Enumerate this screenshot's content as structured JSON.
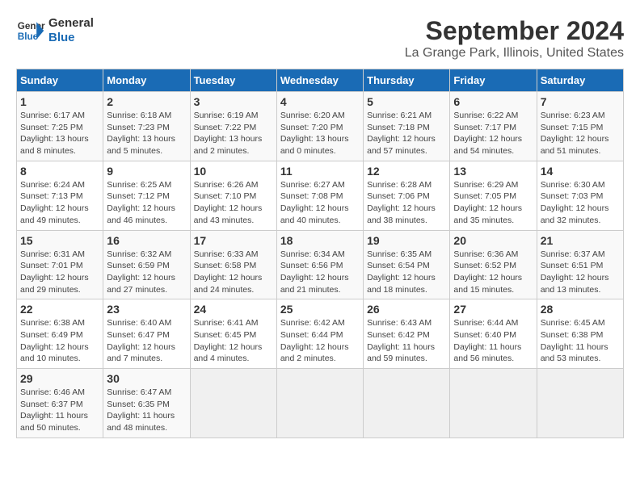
{
  "header": {
    "logo_line1": "General",
    "logo_line2": "Blue",
    "title": "September 2024",
    "subtitle": "La Grange Park, Illinois, United States"
  },
  "days_of_week": [
    "Sunday",
    "Monday",
    "Tuesday",
    "Wednesday",
    "Thursday",
    "Friday",
    "Saturday"
  ],
  "weeks": [
    [
      {
        "day": "1",
        "info": "Sunrise: 6:17 AM\nSunset: 7:25 PM\nDaylight: 13 hours\nand 8 minutes."
      },
      {
        "day": "2",
        "info": "Sunrise: 6:18 AM\nSunset: 7:23 PM\nDaylight: 13 hours\nand 5 minutes."
      },
      {
        "day": "3",
        "info": "Sunrise: 6:19 AM\nSunset: 7:22 PM\nDaylight: 13 hours\nand 2 minutes."
      },
      {
        "day": "4",
        "info": "Sunrise: 6:20 AM\nSunset: 7:20 PM\nDaylight: 13 hours\nand 0 minutes."
      },
      {
        "day": "5",
        "info": "Sunrise: 6:21 AM\nSunset: 7:18 PM\nDaylight: 12 hours\nand 57 minutes."
      },
      {
        "day": "6",
        "info": "Sunrise: 6:22 AM\nSunset: 7:17 PM\nDaylight: 12 hours\nand 54 minutes."
      },
      {
        "day": "7",
        "info": "Sunrise: 6:23 AM\nSunset: 7:15 PM\nDaylight: 12 hours\nand 51 minutes."
      }
    ],
    [
      {
        "day": "8",
        "info": "Sunrise: 6:24 AM\nSunset: 7:13 PM\nDaylight: 12 hours\nand 49 minutes."
      },
      {
        "day": "9",
        "info": "Sunrise: 6:25 AM\nSunset: 7:12 PM\nDaylight: 12 hours\nand 46 minutes."
      },
      {
        "day": "10",
        "info": "Sunrise: 6:26 AM\nSunset: 7:10 PM\nDaylight: 12 hours\nand 43 minutes."
      },
      {
        "day": "11",
        "info": "Sunrise: 6:27 AM\nSunset: 7:08 PM\nDaylight: 12 hours\nand 40 minutes."
      },
      {
        "day": "12",
        "info": "Sunrise: 6:28 AM\nSunset: 7:06 PM\nDaylight: 12 hours\nand 38 minutes."
      },
      {
        "day": "13",
        "info": "Sunrise: 6:29 AM\nSunset: 7:05 PM\nDaylight: 12 hours\nand 35 minutes."
      },
      {
        "day": "14",
        "info": "Sunrise: 6:30 AM\nSunset: 7:03 PM\nDaylight: 12 hours\nand 32 minutes."
      }
    ],
    [
      {
        "day": "15",
        "info": "Sunrise: 6:31 AM\nSunset: 7:01 PM\nDaylight: 12 hours\nand 29 minutes."
      },
      {
        "day": "16",
        "info": "Sunrise: 6:32 AM\nSunset: 6:59 PM\nDaylight: 12 hours\nand 27 minutes."
      },
      {
        "day": "17",
        "info": "Sunrise: 6:33 AM\nSunset: 6:58 PM\nDaylight: 12 hours\nand 24 minutes."
      },
      {
        "day": "18",
        "info": "Sunrise: 6:34 AM\nSunset: 6:56 PM\nDaylight: 12 hours\nand 21 minutes."
      },
      {
        "day": "19",
        "info": "Sunrise: 6:35 AM\nSunset: 6:54 PM\nDaylight: 12 hours\nand 18 minutes."
      },
      {
        "day": "20",
        "info": "Sunrise: 6:36 AM\nSunset: 6:52 PM\nDaylight: 12 hours\nand 15 minutes."
      },
      {
        "day": "21",
        "info": "Sunrise: 6:37 AM\nSunset: 6:51 PM\nDaylight: 12 hours\nand 13 minutes."
      }
    ],
    [
      {
        "day": "22",
        "info": "Sunrise: 6:38 AM\nSunset: 6:49 PM\nDaylight: 12 hours\nand 10 minutes."
      },
      {
        "day": "23",
        "info": "Sunrise: 6:40 AM\nSunset: 6:47 PM\nDaylight: 12 hours\nand 7 minutes."
      },
      {
        "day": "24",
        "info": "Sunrise: 6:41 AM\nSunset: 6:45 PM\nDaylight: 12 hours\nand 4 minutes."
      },
      {
        "day": "25",
        "info": "Sunrise: 6:42 AM\nSunset: 6:44 PM\nDaylight: 12 hours\nand 2 minutes."
      },
      {
        "day": "26",
        "info": "Sunrise: 6:43 AM\nSunset: 6:42 PM\nDaylight: 11 hours\nand 59 minutes."
      },
      {
        "day": "27",
        "info": "Sunrise: 6:44 AM\nSunset: 6:40 PM\nDaylight: 11 hours\nand 56 minutes."
      },
      {
        "day": "28",
        "info": "Sunrise: 6:45 AM\nSunset: 6:38 PM\nDaylight: 11 hours\nand 53 minutes."
      }
    ],
    [
      {
        "day": "29",
        "info": "Sunrise: 6:46 AM\nSunset: 6:37 PM\nDaylight: 11 hours\nand 50 minutes."
      },
      {
        "day": "30",
        "info": "Sunrise: 6:47 AM\nSunset: 6:35 PM\nDaylight: 11 hours\nand 48 minutes."
      },
      {
        "day": "",
        "info": ""
      },
      {
        "day": "",
        "info": ""
      },
      {
        "day": "",
        "info": ""
      },
      {
        "day": "",
        "info": ""
      },
      {
        "day": "",
        "info": ""
      }
    ]
  ]
}
